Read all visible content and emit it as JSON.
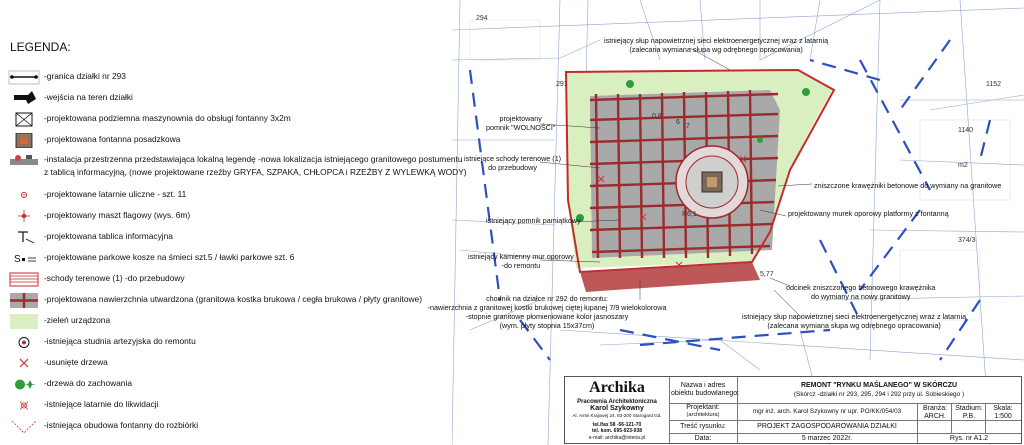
{
  "legend": {
    "title": "LEGENDA:",
    "items": [
      {
        "symbol": "parcel-boundary-icon",
        "label": "-granica działki  nr 293"
      },
      {
        "symbol": "entrance-arrow-icon",
        "label": "-wejścia na teren działki"
      },
      {
        "symbol": "machine-room-icon",
        "label": "-projektowana podziemna maszynownia do obsługi fontanny 3x2m"
      },
      {
        "symbol": "fountain-icon",
        "label": "-projektowana fontanna posadzkowa"
      },
      {
        "symbol": "installation-icon",
        "label": "-instalacja przestrzenna przedstawiająca lokalną legendę -nowa lokalizacja istniejącego granitowego postumentu"
      },
      {
        "symbol": "",
        "label": "z tablicą informacyjną, (nowe projektowane rzeźby GRYFA, SZPAKA, CHŁOPCA i RZEŹBY Z WYLEWKĄ WODY)"
      },
      {
        "symbol": "street-lamp-icon",
        "label": "-projektowane latarnie uliczne - szt. 11"
      },
      {
        "symbol": "flagpole-icon",
        "label": "-projektowany maszt flagowy (wys. 6m)"
      },
      {
        "symbol": "info-board-icon",
        "label": "-projektowana tablica informacyjna"
      },
      {
        "symbol": "bench-icon",
        "label": "-projektowane parkowe kosze na śmieci szt.5 / ławki parkowe szt. 6"
      },
      {
        "symbol": "steps-icon",
        "label": "-schody terenowe (1) -do przebudowy"
      },
      {
        "symbol": "paving-icon",
        "label": "-projektowana nawierzchnia utwardzona (granitowa kostka brukowa / cegła brukowa / płyty granitowe)"
      },
      {
        "symbol": "greenery-icon",
        "label": "-zieleń urządzona"
      },
      {
        "symbol": "well-icon",
        "label": "-istniejąca studnia artezyjska do remontu"
      },
      {
        "symbol": "removed-tree-icon",
        "label": "-usunięte drzewa"
      },
      {
        "symbol": "kept-tree-icon",
        "label": "-drzewa do zachowania"
      },
      {
        "symbol": "old-lamp-icon",
        "label": "-istniejące latarnie do likwidacji"
      },
      {
        "symbol": "old-fountain-icon",
        "label": "-istniejąca obudowa fontanny do rozbiórki"
      }
    ]
  },
  "annotations": {
    "pole_top": "istniejący słup napowietrznej sieci elektroenergetycznej wraz z latarnią",
    "pole_top_2": "(zalecana wymiana słupa wg odrębnego opracowania)",
    "monument": "projektowany",
    "monument_2": "pomnik \"WOLNOŚCI\"",
    "stairs": "istniejące schody terenowe (1)",
    "stairs_2": "do przebudowy",
    "memorial": "istniejący pomnik pamiątkowy",
    "wall": "istniejący kamienny mur oporowy",
    "wall_2": "-do remontu",
    "curb": "zniszczone krawężniki betonowe do wymiany na granitowe",
    "retaining_wall": "projektowany murek oporowy platformy z fontanną",
    "sidewalk": "chodnik na działce nr 292 do remontu:",
    "sidewalk_2": "-nawierzchnia z granitowej kostki brukowej ciętej łupanej 7/9 wielokolorowa",
    "sidewalk_3": "-stopnie granitowe płomieniowane kolor jasnoszary",
    "sidewalk_4": "(wym. płyty stopnia 15x37cm)",
    "curb_segment": "odcinek zniszczonego betonowego krawężnika",
    "curb_segment_2": "do wymiany na nowy granitowy",
    "pole_bottom": "istniejący słup napowietrznej sieci elektroenergetycznej wraz z latarnią",
    "pole_bottom_2": "(zalecana wymiana słupa wg odrębnego opracowania)"
  },
  "title_block": {
    "company": "Archika",
    "company_sub": "Pracownia Architektoniczna",
    "architect": "Karol Szykowny",
    "address": "Al. Armii Krajowej 24, 83-200 Starogard Gd.",
    "tel1": "tel./fax  58 -56-121-70",
    "tel2": "tel. kom.  695-923-938",
    "email": "e-mail: archika@interia.pl",
    "name_label": "Nazwa i adres",
    "name_label_2": "obiektu budowlanego:",
    "name_value": "REMONT \"RYNKU MAŚLANEGO\" W SKÓRCZU",
    "name_value_2": "(Skórcz -działki nr 293, 295, 294 i 292  przy ul. Sobieskiego )",
    "designer_label": "Projektant:",
    "designer_label_2": "(architektura)",
    "designer_value": "mgr inż. arch. Karol Szykowny nr upr. PO/KK/054/03",
    "branch_label": "Branża:",
    "branch_value": "ARCH.",
    "stage_label": "Stadium:",
    "stage_value": "P.B.",
    "scale_label": "Skala:",
    "scale_value": "1:500",
    "drawing_label": "Treść rysunku:",
    "drawing_value": "PROJEKT ZAGOSPODAROWANIA DZIAŁKI",
    "date_label": "Data:",
    "date_value": "5 marzec 2022r.",
    "sheet_value": "Rys. nr A1.2"
  },
  "map_labels": {
    "l1140": "1140",
    "l374": "374/3",
    "l1152": "1152",
    "l294": "294",
    "l291": "291",
    "lm2": "m2",
    "d08": "0,8",
    "d6": "6",
    "d7": "7",
    "dR": "R6,1",
    "d577": "5,77"
  },
  "colors": {
    "paving": "#a9a9a9",
    "brick": "#9c2b2b",
    "green": "#d9efc0",
    "boundary": "#c52a2a",
    "blue_dash": "#2e4fbf"
  }
}
